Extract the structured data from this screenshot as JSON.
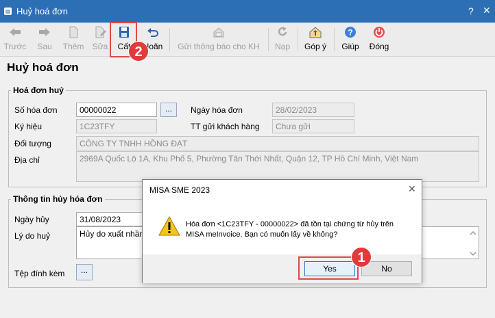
{
  "window": {
    "title": "Huỷ hoá đơn",
    "help": "?",
    "close": "✕"
  },
  "toolbar": {
    "back": "Trước",
    "next": "Sau",
    "add": "Thêm",
    "edit": "Sửa",
    "save": "Cất",
    "undo": "Hoãn",
    "send_notice": "Gửi thông báo cho KH",
    "load": "Nạp",
    "feedback": "Góp ý",
    "help": "Giúp",
    "close": "Đóng"
  },
  "page_title": "Huỷ hoá đơn",
  "invoice_group": {
    "title": "Hoá đơn huỷ",
    "invoice_no_label": "Số hóa đơn",
    "invoice_no": "00000022",
    "browse": "...",
    "invoice_date_label": "Ngày hóa đơn",
    "invoice_date": "28/02/2023",
    "symbol_label": "Ký hiệu",
    "symbol": "1C23TFY",
    "status_label": "TT gửi khách hàng",
    "status": "Chưa gửi",
    "party_label": "Đối tượng",
    "party": "CÔNG TY TNHH HỒNG ĐẠT",
    "address_label": "Địa chỉ",
    "address": "2969A Quốc Lộ 1A, Khu Phố 5, Phường Tân Thới Nhất, Quận 12, TP Hồ Chí Minh, Việt Nam"
  },
  "cancel_group": {
    "title": "Thông tin hủy hóa đơn",
    "date_label": "Ngày hủy",
    "date": "31/08/2023",
    "reason_label": "Lý do huỷ",
    "reason": "Hủy do xuất nhầm",
    "attach_label": "Tệp đính kèm",
    "attach_btn": "..."
  },
  "dialog": {
    "title": "MISA SME 2023",
    "close": "✕",
    "message_line1": "Hóa đơn <1C23TFY - 00000022> đã tồn tại chứng từ hủy trên",
    "message_line2": "MISA meInvoice. Bạn có muốn lấy về không?",
    "yes": "Yes",
    "no": "No"
  },
  "callouts": {
    "step1": "1",
    "step2": "2"
  },
  "colors": {
    "titlebar": "#2c6fb4",
    "callout": "#e03b3b",
    "primary_border": "#2a70c8"
  }
}
